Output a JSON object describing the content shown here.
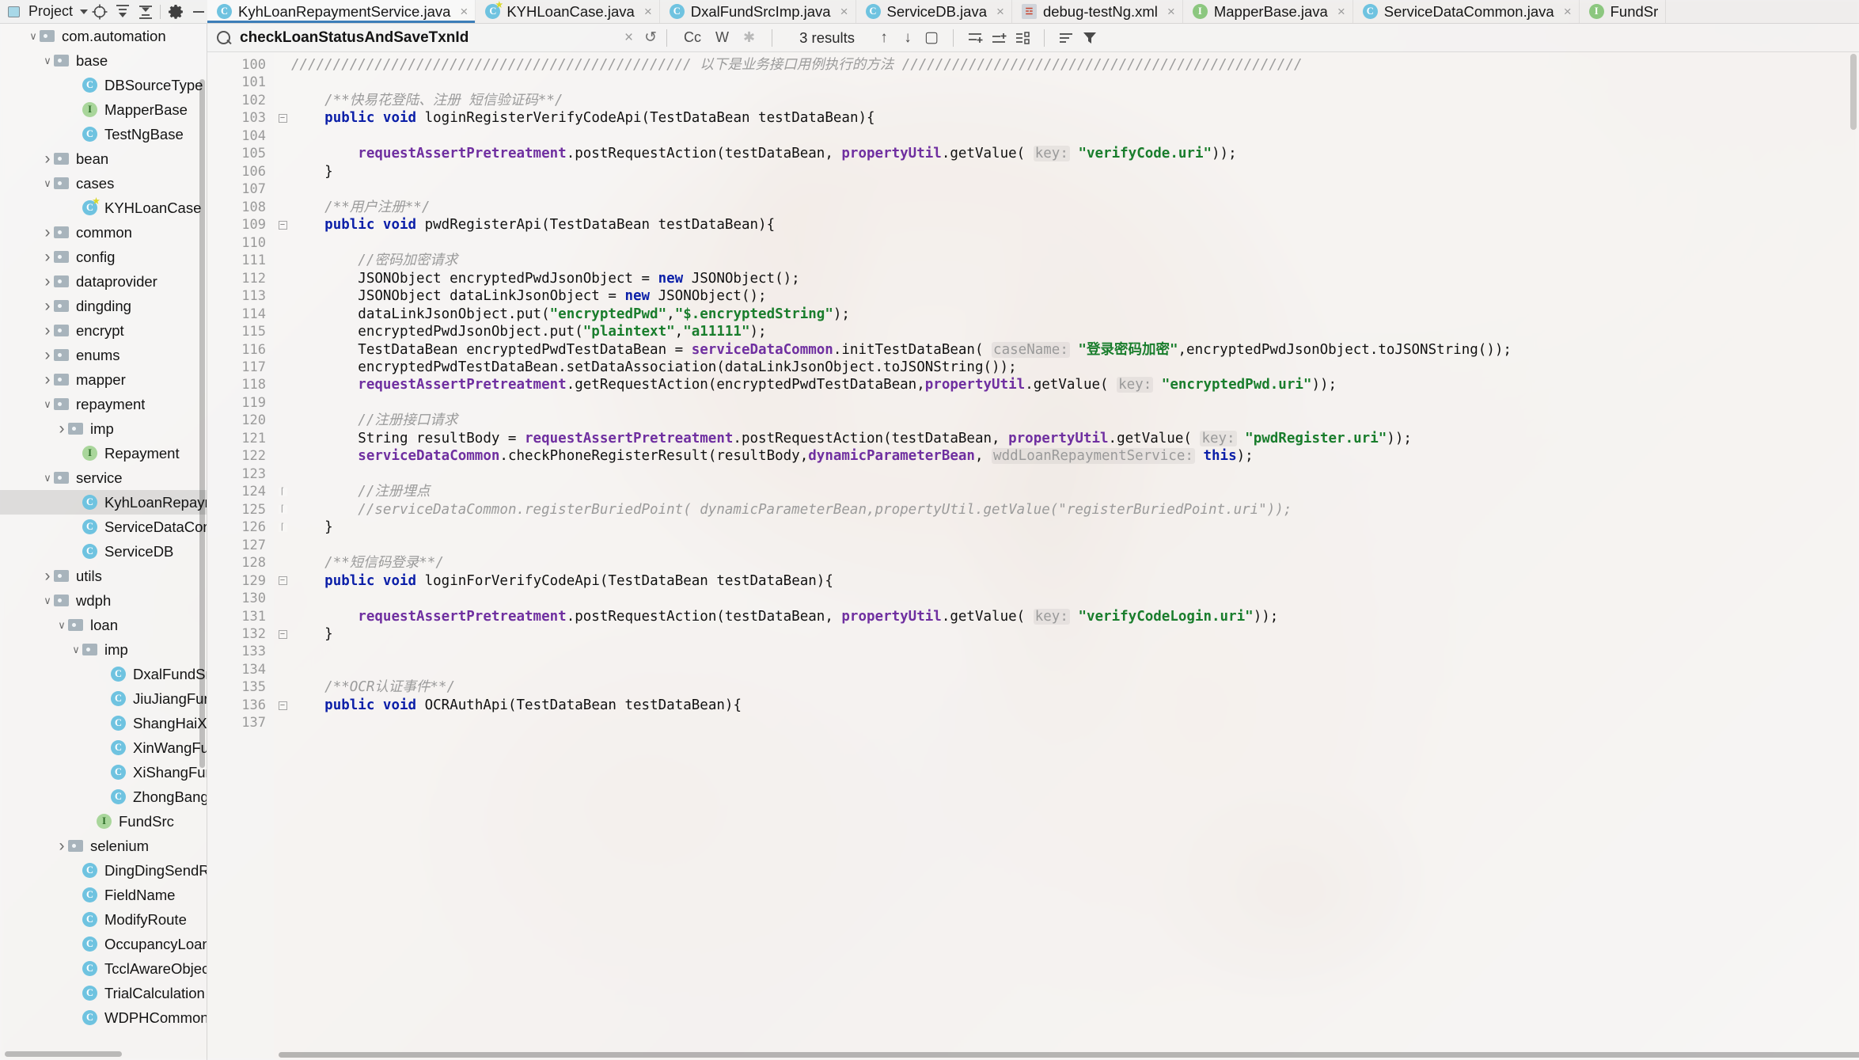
{
  "window": {
    "project_panel": {
      "label": "Project",
      "icons": [
        "target-icon",
        "expand-all-icon",
        "collapse-all-icon",
        "gear-icon",
        "minimize-icon"
      ]
    }
  },
  "tabs": [
    {
      "label": "KyhLoanRepaymentService.java",
      "icon": "class-icon",
      "active": true,
      "close": "×"
    },
    {
      "label": "KYHLoanCase.java",
      "icon": "class-run-icon",
      "active": false,
      "close": "×"
    },
    {
      "label": "DxalFundSrcImp.java",
      "icon": "class-icon",
      "active": false,
      "close": "×"
    },
    {
      "label": "ServiceDB.java",
      "icon": "class-icon",
      "active": false,
      "close": "×"
    },
    {
      "label": "debug-testNg.xml",
      "icon": "xml-icon",
      "active": false,
      "close": "×"
    },
    {
      "label": "MapperBase.java",
      "icon": "interface-icon",
      "active": false,
      "close": "×"
    },
    {
      "label": "ServiceDataCommon.java",
      "icon": "class-icon",
      "active": false,
      "close": "×"
    },
    {
      "label": "FundSr",
      "icon": "interface-icon",
      "active": false,
      "close": ""
    }
  ],
  "find_bar": {
    "query": "checkLoanStatusAndSaveTxnId",
    "clear": "×",
    "history": "↺",
    "match_case": "Cc",
    "words": "W",
    "regex": "✱",
    "results": "3 results",
    "prev": "↑",
    "next": "↓",
    "select_all": "▢",
    "icons": [
      "add-line-above-icon",
      "add-line-below-icon",
      "multi-select-icon",
      "filter-list-icon",
      "filter-icon"
    ]
  },
  "sidebar": {
    "items": [
      {
        "indent": 1,
        "type": "folder",
        "arrow": "v",
        "label": "com.automation",
        "selected": false
      },
      {
        "indent": 2,
        "type": "folder",
        "arrow": "v",
        "label": "base",
        "selected": false
      },
      {
        "indent": 4,
        "type": "class",
        "arrow": "",
        "label": "DBSourceType",
        "selected": false
      },
      {
        "indent": 4,
        "type": "interface",
        "arrow": "",
        "label": "MapperBase",
        "selected": false
      },
      {
        "indent": 4,
        "type": "class",
        "arrow": "",
        "label": "TestNgBase",
        "selected": false
      },
      {
        "indent": 2,
        "type": "folder",
        "arrow": ">",
        "label": "bean",
        "selected": false
      },
      {
        "indent": 2,
        "type": "folder",
        "arrow": "v",
        "label": "cases",
        "selected": false
      },
      {
        "indent": 4,
        "type": "class-run",
        "arrow": "",
        "label": "KYHLoanCase",
        "selected": false
      },
      {
        "indent": 2,
        "type": "folder",
        "arrow": ">",
        "label": "common",
        "selected": false
      },
      {
        "indent": 2,
        "type": "folder",
        "arrow": ">",
        "label": "config",
        "selected": false
      },
      {
        "indent": 2,
        "type": "folder",
        "arrow": ">",
        "label": "dataprovider",
        "selected": false
      },
      {
        "indent": 2,
        "type": "folder",
        "arrow": ">",
        "label": "dingding",
        "selected": false
      },
      {
        "indent": 2,
        "type": "folder",
        "arrow": ">",
        "label": "encrypt",
        "selected": false
      },
      {
        "indent": 2,
        "type": "folder",
        "arrow": ">",
        "label": "enums",
        "selected": false
      },
      {
        "indent": 2,
        "type": "folder",
        "arrow": ">",
        "label": "mapper",
        "selected": false
      },
      {
        "indent": 2,
        "type": "folder",
        "arrow": "v",
        "label": "repayment",
        "selected": false
      },
      {
        "indent": 3,
        "type": "folder",
        "arrow": ">",
        "label": "imp",
        "selected": false
      },
      {
        "indent": 4,
        "type": "interface",
        "arrow": "",
        "label": "Repayment",
        "selected": false
      },
      {
        "indent": 2,
        "type": "folder",
        "arrow": "v",
        "label": "service",
        "selected": false
      },
      {
        "indent": 4,
        "type": "class",
        "arrow": "",
        "label": "KyhLoanRepaymentSe",
        "selected": true
      },
      {
        "indent": 4,
        "type": "class",
        "arrow": "",
        "label": "ServiceDataCommon",
        "selected": false
      },
      {
        "indent": 4,
        "type": "class",
        "arrow": "",
        "label": "ServiceDB",
        "selected": false
      },
      {
        "indent": 2,
        "type": "folder",
        "arrow": ">",
        "label": "utils",
        "selected": false
      },
      {
        "indent": 2,
        "type": "folder",
        "arrow": "v",
        "label": "wdph",
        "selected": false
      },
      {
        "indent": 3,
        "type": "folder",
        "arrow": "v",
        "label": "loan",
        "selected": false
      },
      {
        "indent": 4,
        "type": "folder",
        "arrow": "v",
        "label": "imp",
        "selected": false
      },
      {
        "indent": 6,
        "type": "class",
        "arrow": "",
        "label": "DxalFundSrcImp",
        "selected": false
      },
      {
        "indent": 6,
        "type": "class",
        "arrow": "",
        "label": "JiuJiangFundSrc",
        "selected": false
      },
      {
        "indent": 6,
        "type": "class",
        "arrow": "",
        "label": "ShangHaiXDFund",
        "selected": false
      },
      {
        "indent": 6,
        "type": "class",
        "arrow": "",
        "label": "XinWangFundSrc",
        "selected": false
      },
      {
        "indent": 6,
        "type": "class",
        "arrow": "",
        "label": "XiShangFundSrc",
        "selected": false
      },
      {
        "indent": 6,
        "type": "class",
        "arrow": "",
        "label": "ZhongBangFundS",
        "selected": false
      },
      {
        "indent": 5,
        "type": "interface",
        "arrow": "",
        "label": "FundSrc",
        "selected": false
      },
      {
        "indent": 3,
        "type": "folder",
        "arrow": ">",
        "label": "selenium",
        "selected": false
      },
      {
        "indent": 4,
        "type": "class",
        "arrow": "",
        "label": "DingDingSendRequest",
        "selected": false
      },
      {
        "indent": 4,
        "type": "class",
        "arrow": "",
        "label": "FieldName",
        "selected": false
      },
      {
        "indent": 4,
        "type": "class",
        "arrow": "",
        "label": "ModifyRoute",
        "selected": false
      },
      {
        "indent": 4,
        "type": "class",
        "arrow": "",
        "label": "OccupancyLoanDays",
        "selected": false
      },
      {
        "indent": 4,
        "type": "class",
        "arrow": "",
        "label": "TcclAwareObjectIputS",
        "selected": false
      },
      {
        "indent": 4,
        "type": "class",
        "arrow": "",
        "label": "TrialCalculation",
        "selected": false
      },
      {
        "indent": 4,
        "type": "class",
        "arrow": "",
        "label": "WDPHCommonReques",
        "selected": false
      }
    ]
  },
  "editor": {
    "first_line": 100,
    "lines": [
      {
        "n": 100,
        "fold": "",
        "html": "<span class='cm'>//////////////////////////////////////////////// 以下是业务接口用例执行的方法 ////////////////////////////////////////////////</span>"
      },
      {
        "n": 101,
        "fold": "",
        "html": ""
      },
      {
        "n": 102,
        "fold": "",
        "html": "    <span class='cm'>/**快易花登陆、注册 短信验证码**/</span>"
      },
      {
        "n": 103,
        "fold": "minus",
        "html": "    <span class='kw'>public</span> <span class='kw'>void</span> loginRegisterVerifyCodeApi(TestDataBean testDataBean){"
      },
      {
        "n": 104,
        "fold": "",
        "html": ""
      },
      {
        "n": 105,
        "fold": "",
        "html": "        <span class='sfld'>requestAssertPretreatment</span>.postRequestAction(testDataBean, <span class='sfld'>propertyUtil</span>.getValue( <span class='hint'>key:</span> <span class='str'>\"verifyCode.uri\"</span>));"
      },
      {
        "n": 106,
        "fold": "",
        "html": "    }"
      },
      {
        "n": 107,
        "fold": "",
        "html": ""
      },
      {
        "n": 108,
        "fold": "",
        "html": "    <span class='cm'>/**用户注册**/</span>"
      },
      {
        "n": 109,
        "fold": "minus",
        "html": "    <span class='kw'>public</span> <span class='kw'>void</span> pwdRegisterApi(TestDataBean testDataBean){"
      },
      {
        "n": 110,
        "fold": "",
        "html": ""
      },
      {
        "n": 111,
        "fold": "",
        "html": "        <span class='cm'>//密码加密请求</span>"
      },
      {
        "n": 112,
        "fold": "",
        "html": "        JSONObject encryptedPwdJsonObject = <span class='kw'>new</span> JSONObject();"
      },
      {
        "n": 113,
        "fold": "",
        "html": "        JSONObject dataLinkJsonObject = <span class='kw'>new</span> JSONObject();"
      },
      {
        "n": 114,
        "fold": "",
        "html": "        dataLinkJsonObject.put(<span class='str'>\"encryptedPwd\"</span>,<span class='str'>\"$.encryptedString\"</span>);"
      },
      {
        "n": 115,
        "fold": "",
        "html": "        encryptedPwdJsonObject.put(<span class='str'>\"plaintext\"</span>,<span class='str'>\"a11111\"</span>);"
      },
      {
        "n": 116,
        "fold": "",
        "html": "        TestDataBean encryptedPwdTestDataBean = <span class='sfld'>serviceDataCommon</span>.initTestDataBean( <span class='hint'>caseName:</span> <span class='str'>\"登录密码加密\"</span>,encryptedPwdJsonObject.toJSONString());"
      },
      {
        "n": 117,
        "fold": "",
        "html": "        encryptedPwdTestDataBean.setDataAssociation(dataLinkJsonObject.toJSONString());"
      },
      {
        "n": 118,
        "fold": "",
        "html": "        <span class='sfld'>requestAssertPretreatment</span>.getRequestAction(encryptedPwdTestDataBean,<span class='sfld'>propertyUtil</span>.getValue( <span class='hint'>key:</span> <span class='str'>\"encryptedPwd.uri\"</span>));"
      },
      {
        "n": 119,
        "fold": "",
        "html": ""
      },
      {
        "n": 120,
        "fold": "",
        "html": "        <span class='cm'>//注册接口请求</span>"
      },
      {
        "n": 121,
        "fold": "",
        "html": "        String resultBody = <span class='sfld'>requestAssertPretreatment</span>.postRequestAction(testDataBean, <span class='sfld'>propertyUtil</span>.getValue( <span class='hint'>key:</span> <span class='str'>\"pwdRegister.uri\"</span>));"
      },
      {
        "n": 122,
        "fold": "",
        "html": "        <span class='sfld'>serviceDataCommon</span>.checkPhoneRegisterResult(resultBody,<span class='sfld'>dynamicParameterBean</span>, <span class='hint'>wddLoanRepaymentService:</span> <span class='kw'>this</span>);"
      },
      {
        "n": 123,
        "fold": "",
        "html": ""
      },
      {
        "n": 124,
        "fold": "plain",
        "html": "        <span class='cm'>//注册埋点</span>"
      },
      {
        "n": 125,
        "fold": "plain",
        "html": "        <span class='cm'>//serviceDataCommon.registerBuriedPoint( dynamicParameterBean,propertyUtil.getValue(\"registerBuriedPoint.uri\"));</span>"
      },
      {
        "n": 126,
        "fold": "plain",
        "html": "    }"
      },
      {
        "n": 127,
        "fold": "",
        "html": ""
      },
      {
        "n": 128,
        "fold": "",
        "html": "    <span class='cm'>/**短信码登录**/</span>"
      },
      {
        "n": 129,
        "fold": "minus",
        "html": "    <span class='kw'>public</span> <span class='kw'>void</span> loginForVerifyCodeApi(TestDataBean testDataBean){"
      },
      {
        "n": 130,
        "fold": "",
        "html": ""
      },
      {
        "n": 131,
        "fold": "",
        "html": "        <span class='sfld'>requestAssertPretreatment</span>.postRequestAction(testDataBean, <span class='sfld'>propertyUtil</span>.getValue( <span class='hint'>key:</span> <span class='str'>\"verifyCodeLogin.uri\"</span>));"
      },
      {
        "n": 132,
        "fold": "minus",
        "html": "    }"
      },
      {
        "n": 133,
        "fold": "",
        "html": ""
      },
      {
        "n": 134,
        "fold": "",
        "html": ""
      },
      {
        "n": 135,
        "fold": "",
        "html": "    <span class='cm'>/**OCR认证事件**/</span>"
      },
      {
        "n": 136,
        "fold": "minus",
        "html": "    <span class='kw'>public</span> <span class='kw'>void</span> OCRAuthApi(TestDataBean testDataBean){"
      },
      {
        "n": 137,
        "fold": "",
        "html": ""
      }
    ]
  },
  "colors": {
    "accent": "#3c7eb8",
    "keyword": "#0b1fa8",
    "string": "#197d2c",
    "comment": "#9b9b9b",
    "field": "#6f2fa0"
  }
}
